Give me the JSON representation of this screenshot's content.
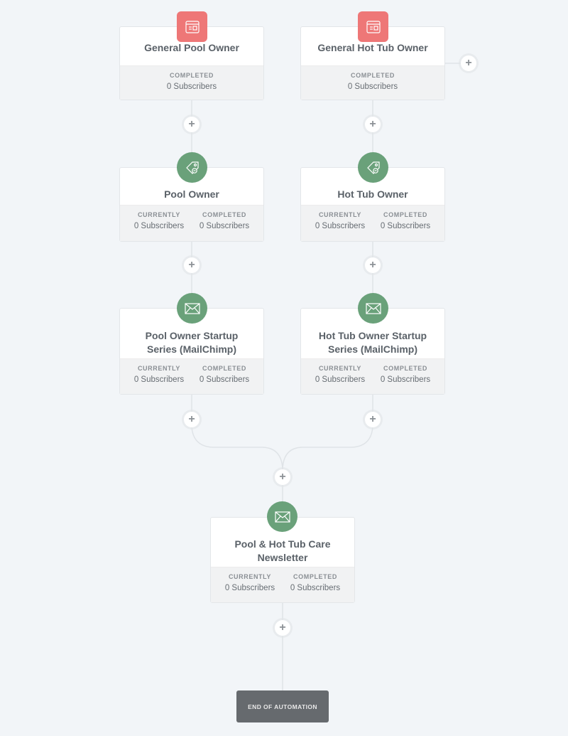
{
  "nodes": {
    "general_pool": {
      "type": "trigger",
      "icon": "form-icon",
      "title": "General Pool Owner",
      "stats": [
        {
          "label": "COMPLETED",
          "value": "0 Subscribers"
        }
      ]
    },
    "general_hot_tub": {
      "type": "trigger",
      "icon": "form-icon",
      "title": "General Hot Tub Owner",
      "stats": [
        {
          "label": "COMPLETED",
          "value": "0 Subscribers"
        }
      ]
    },
    "pool_owner": {
      "type": "tag",
      "icon": "tag-icon",
      "title": "Pool Owner",
      "stats": [
        {
          "label": "CURRENTLY",
          "value": "0 Subscribers"
        },
        {
          "label": "COMPLETED",
          "value": "0 Subscribers"
        }
      ]
    },
    "hot_tub_owner": {
      "type": "tag",
      "icon": "tag-icon",
      "title": "Hot Tub Owner",
      "stats": [
        {
          "label": "CURRENTLY",
          "value": "0 Subscribers"
        },
        {
          "label": "COMPLETED",
          "value": "0 Subscribers"
        }
      ]
    },
    "pool_series": {
      "type": "email",
      "icon": "envelope-icon",
      "title": "Pool Owner Startup Series (MailChimp)",
      "stats": [
        {
          "label": "CURRENTLY",
          "value": "0 Subscribers"
        },
        {
          "label": "COMPLETED",
          "value": "0 Subscribers"
        }
      ]
    },
    "hot_tub_series": {
      "type": "email",
      "icon": "envelope-icon",
      "title": "Hot Tub Owner Startup Series (MailChimp)",
      "stats": [
        {
          "label": "CURRENTLY",
          "value": "0 Subscribers"
        },
        {
          "label": "COMPLETED",
          "value": "0 Subscribers"
        }
      ]
    },
    "newsletter": {
      "type": "email",
      "icon": "envelope-icon",
      "title": "Pool & Hot Tub Care Newsletter",
      "stats": [
        {
          "label": "CURRENTLY",
          "value": "0 Subscribers"
        },
        {
          "label": "COMPLETED",
          "value": "0 Subscribers"
        }
      ]
    }
  },
  "add_step_symbol": "+",
  "end": {
    "label": "END OF AUTOMATION"
  },
  "colors": {
    "trigger": "#ee7777",
    "action": "#6aa17a",
    "end": "#666a6e",
    "background": "#f2f5f8"
  }
}
